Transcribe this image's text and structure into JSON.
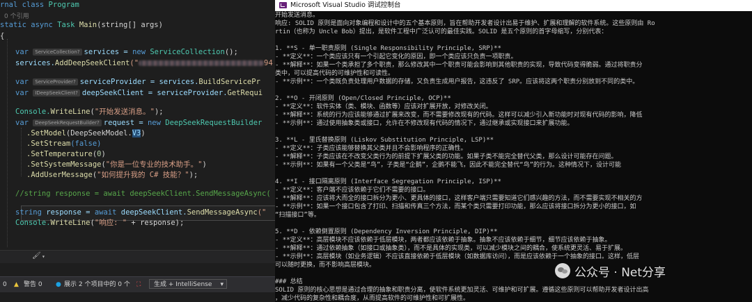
{
  "editor": {
    "lines": {
      "l1_kw": "rnal class",
      "l1_name": "Program",
      "l2_hint": "0 个引用",
      "l3_static": "static",
      "l3_async": "async",
      "l3_task": "Task",
      "l3_main": "Main",
      "l3_params": "(string[] args)",
      "l4_brace": "{",
      "l5_var": "var",
      "l5_tag": "ServiceCollection?",
      "l5_rest_a": "services = ",
      "l5_new": "new",
      "l5_rest_b": "ServiceCollection",
      "l5_rest_c": "();",
      "l6_a": "services.",
      "l6_fn": "AddDeepSeekClient",
      "l6_b": "(\"",
      "l6_tail": "94",
      "l8_var": "var",
      "l8_tag": "ServiceProvider?",
      "l8_rest": "serviceProvider = services.",
      "l8_fn": "BuildServicePr",
      "l9_var": "var",
      "l9_tag": "IDeepSeekClient?",
      "l9_rest": "deepSeekClient = serviceProvider.",
      "l9_fn": "GetRequi",
      "l11_a": "Console.",
      "l11_fn": "WriteLine",
      "l11_str": "\"开始发送消息。\"",
      "l11_end": ");",
      "l12_var": "var",
      "l12_tag": "DeepSeekRequestBuilder?",
      "l12_rest": "request = ",
      "l12_new": "new",
      "l12_type": "DeepSeekRequestBuilder",
      "l13_fn": ".SetModel",
      "l13_arg": "(DeepSeekModel.",
      "l13_sel": "V3",
      "l13_end": ")",
      "l14_fn": ".SetStream",
      "l14_arg": "(false)",
      "l15_fn": ".SetTemperature",
      "l15_num": "0",
      "l16_fn": ".SetSystemMessage",
      "l16_str": "\"你是一位专业的技术助手。\"",
      "l17_fn": ".AddUserMessage",
      "l17_str": "\"如何提升我的 C# 技能？\"",
      "l17_end": ");",
      "l19_comment": "//string response = await deepSeekClient.SendMessageAsync(",
      "l21_string": "string",
      "l21_rest": "response = ",
      "l21_await": "await",
      "l21_b": "deepSeekClient.",
      "l21_fn": "SendMessageAsync",
      "l21_c": "(\"",
      "l22_a": "Console.",
      "l22_fn": "WriteLine",
      "l22_str": "\"响应: \"",
      "l22_b": " + response);"
    },
    "status": {
      "errors": "0",
      "warnings_label": "警告",
      "warnings": "0",
      "projects_text": "展示 2 个项目中的 0 个",
      "build_option": "生成 + IntelliSense"
    }
  },
  "console": {
    "title": "Microsoft Visual Studio 调试控制台",
    "lines": [
      "开始发送消息。",
      "响应: SOLID 原则是面向对象编程和设计中的五个基本原则，旨在帮助开发者设计出易于维护、扩展和理解的软件系统。这些原则由 Ro",
      "rtin（也称为 Uncle Bob）提出，是软件工程中广泛认可的最佳实践。SOLID 是五个原则的首字母缩写，分别代表：",
      "",
      "1. **S - 单一职责原则 (Single Responsibility Principle, SRP)**",
      "   - **定义**：一个类应该只有一个引起它变化的原因，即一个类应该只负责一项职责。",
      "   - **解释**：如果一个类承担了多个职责，那么修改其中一个职责可能会影响到其他职责的实现，导致代码变得脆弱。通过将职责分",
      "类中，可以提高代码的可维护性和可读性。",
      "   - **示例**：一个类既负责处理用户数据的存储，又负责生成用户报告，这违反了 SRP。应该将这两个职责分别放到不同的类中。",
      "",
      "2. **O - 开闭原则 (Open/Closed Principle, OCP)**",
      "   - **定义**：软件实体（类、模块、函数等）应该对扩展开放，对修改关闭。",
      "   - **解释**：系统的行为应该能够通过扩展来改变，而不需要修改现有的代码。这样可以减少引入新功能时对现有代码的影响，降低",
      "   - **示例**：通过使用抽象类或接口，允许在不修改现有代码的情况下，通过继承或实现接口来扩展功能。",
      "",
      "3. **L - 里氏替换原则 (Liskov Substitution Principle, LSP)**",
      "   - **定义**：子类应该能够替换其父类并且不会影响程序的正确性。",
      "   - **解释**：子类应该在不改变父类行为的前提下扩展父类的功能。如果子类不能完全替代父类，那么设计可能存在问题。",
      "   - **示例**：如果有一个父类是“鸟”，子类是“企鹅”，企鹅不能飞，因此不能完全替代“鸟”的行为。这种情况下，设计可能",
      "",
      "4. **I - 接口隔离原则 (Interface Segregation Principle, ISP)**",
      "   - **定义**：客户端不应该依赖于它们不需要的接口。",
      "   - **解释**：应该将大而全的接口拆分为更小、更具体的接口，这样客户端只需要知道它们感兴趣的方法，而不需要实现不相关的方",
      "   - **示例**：如果一个接口包含了打印、扫描和传真三个方法，而某个类只需要打印功能，那么应该将接口拆分为更小的接口，如",
      "“扫描接口”等。",
      "",
      "5. **D - 依赖倒置原则 (Dependency Inversion Principle, DIP)**",
      "   - **定义**：高层模块不应该依赖于低层模块，两者都应该依赖于抽象。抽象不应该依赖于细节，细节应该依赖于抽象。",
      "   - **解释**：通过依赖抽象（如接口或抽象类），而不是具体的实现类，可以减少模块之间的耦合，使系统更灵活、易于扩展。",
      "   - **示例**：高层模块（如业务逻辑）不应该直接依赖于低层模块（如数据库访问），而是应该依赖于一个抽象的接口。这样，低层",
      "可以随时更换，而不影响高层模块。",
      "",
      "### 总结",
      "SOLID 原则的核心思想是通过合理的抽象和职责分离，使软件系统更加灵活、可维护和可扩展。遵循这些原则可以帮助开发者设计出高",
      "，减少代码的复杂性和耦合度，从而提高软件的可维护性和可扩展性。"
    ]
  },
  "watermark": {
    "text": "公众号 · Net分享"
  }
}
